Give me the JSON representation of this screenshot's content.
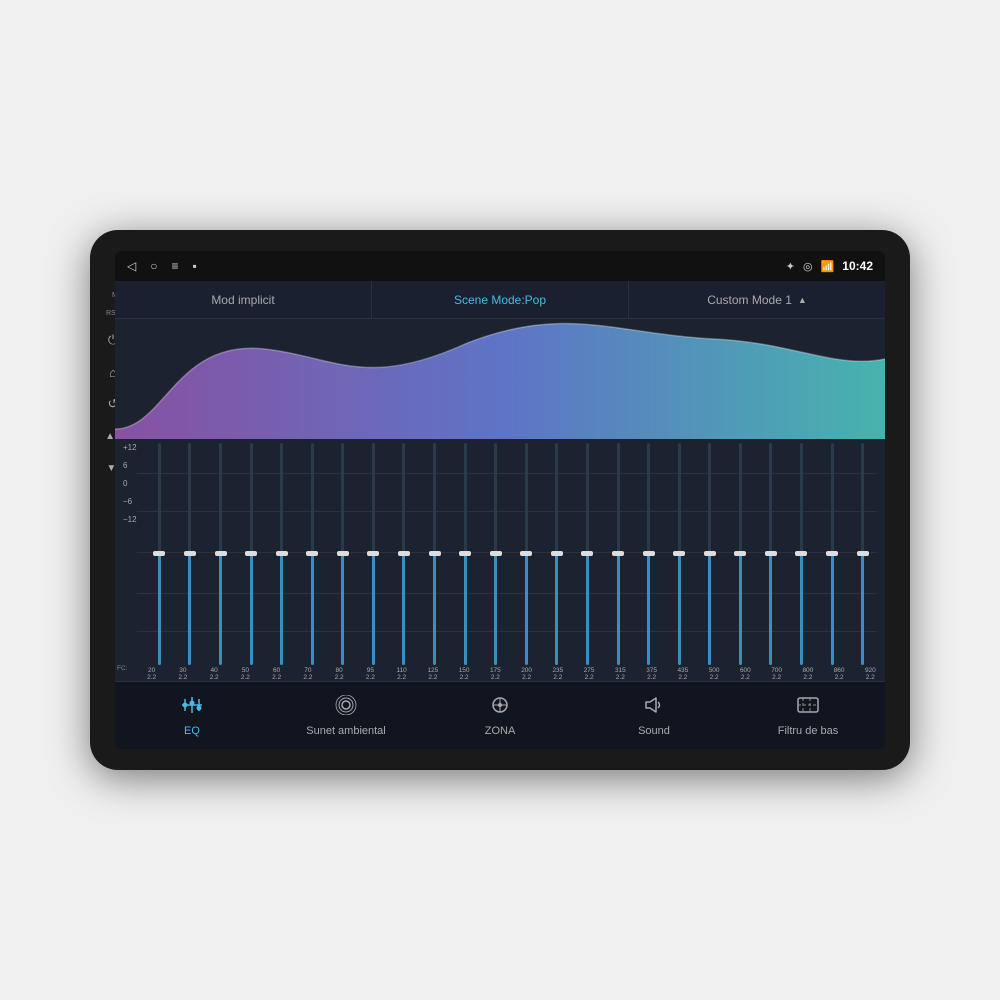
{
  "device": {
    "mic_label": "MIC",
    "rst_label": "RST"
  },
  "status_bar": {
    "time": "10:42",
    "icons": [
      "bluetooth",
      "location",
      "wifi",
      "signal"
    ]
  },
  "mode_bar": {
    "items": [
      {
        "label": "Mod implicit",
        "active": false
      },
      {
        "label": "Scene Mode:Pop",
        "active": true
      },
      {
        "label": "Custom Mode 1",
        "active": false,
        "arrow": "▲"
      }
    ]
  },
  "eq_sliders": {
    "db_labels": [
      "+12",
      "6",
      "0",
      "−6",
      "−12"
    ],
    "frequencies": [
      {
        "fc": "20",
        "q": "2.2",
        "position": 50
      },
      {
        "fc": "30",
        "q": "2.2",
        "position": 50
      },
      {
        "fc": "40",
        "q": "2.2",
        "position": 50
      },
      {
        "fc": "50",
        "q": "2.2",
        "position": 50
      },
      {
        "fc": "60",
        "q": "2.2",
        "position": 50
      },
      {
        "fc": "70",
        "q": "2.2",
        "position": 50
      },
      {
        "fc": "80",
        "q": "2.2",
        "position": 50
      },
      {
        "fc": "95",
        "q": "2.2",
        "position": 50
      },
      {
        "fc": "110",
        "q": "2.2",
        "position": 50
      },
      {
        "fc": "125",
        "q": "2.2",
        "position": 50
      },
      {
        "fc": "150",
        "q": "2.2",
        "position": 50
      },
      {
        "fc": "175",
        "q": "2.2",
        "position": 50
      },
      {
        "fc": "200",
        "q": "2.2",
        "position": 50
      },
      {
        "fc": "235",
        "q": "2.2",
        "position": 50
      },
      {
        "fc": "275",
        "q": "2.2",
        "position": 50
      },
      {
        "fc": "315",
        "q": "2.2",
        "position": 50
      },
      {
        "fc": "375",
        "q": "2.2",
        "position": 50
      },
      {
        "fc": "435",
        "q": "2.2",
        "position": 50
      },
      {
        "fc": "500",
        "q": "2.2",
        "position": 50
      },
      {
        "fc": "600",
        "q": "2.2",
        "position": 50
      },
      {
        "fc": "700",
        "q": "2.2",
        "position": 50
      },
      {
        "fc": "800",
        "q": "2.2",
        "position": 50
      },
      {
        "fc": "860",
        "q": "2.2",
        "position": 50
      },
      {
        "fc": "920",
        "q": "2.2",
        "position": 50
      }
    ]
  },
  "tab_bar": {
    "items": [
      {
        "label": "EQ",
        "icon": "eq",
        "active": true
      },
      {
        "label": "Sunet ambiental",
        "icon": "ambient",
        "active": false
      },
      {
        "label": "ZONA",
        "icon": "zone",
        "active": false
      },
      {
        "label": "Sound",
        "icon": "sound",
        "active": false
      },
      {
        "label": "Filtru de bas",
        "icon": "bass",
        "active": false
      }
    ]
  }
}
